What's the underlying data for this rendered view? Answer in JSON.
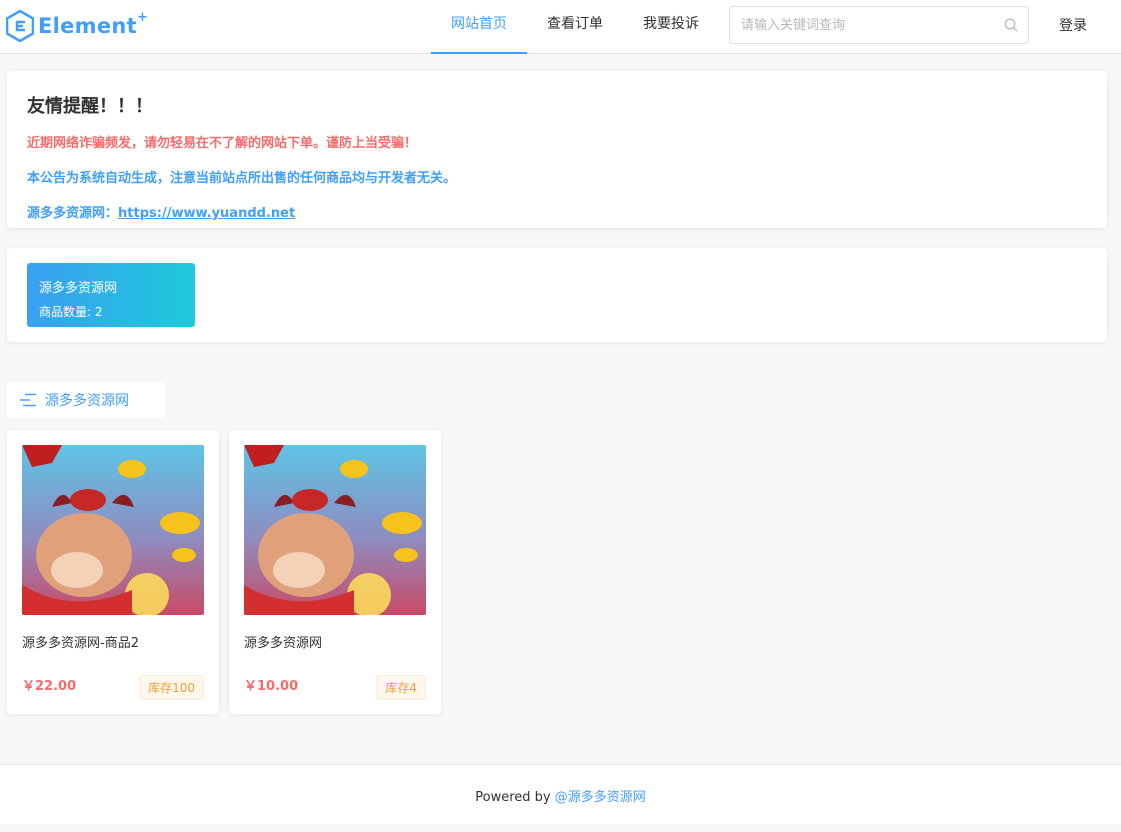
{
  "header": {
    "logo_text": "Element",
    "logo_plus": "+",
    "nav": [
      "网站首页",
      "查看订单",
      "我要投诉"
    ],
    "search_placeholder": "请输入关键词查询",
    "login_label": "登录"
  },
  "notice": {
    "title": "友情提醒！！！",
    "line1": "近期网络诈骗频发，请勿轻易在不了解的网站下单。谨防上当受骗！",
    "line2": "本公告为系统自动生成，注意当前站点所出售的任何商品均与开发者无关。",
    "line3_prefix": "源多多资源网：",
    "line3_link": "https://www.yuandd.net"
  },
  "category": {
    "name": "源多多资源网",
    "count_label": "商品数量: 2"
  },
  "section_title": "源多多资源网",
  "products": [
    {
      "name": "源多多资源网-商品2",
      "price": "￥22.00",
      "stock": "库存100"
    },
    {
      "name": "源多多资源网",
      "price": "￥10.00",
      "stock": "库存4"
    }
  ],
  "footer": {
    "powered": "Powered by ",
    "link": "@源多多资源网"
  },
  "colors": {
    "accent": "#409eff",
    "danger": "#f56c6c",
    "warning": "#e6a23c"
  }
}
